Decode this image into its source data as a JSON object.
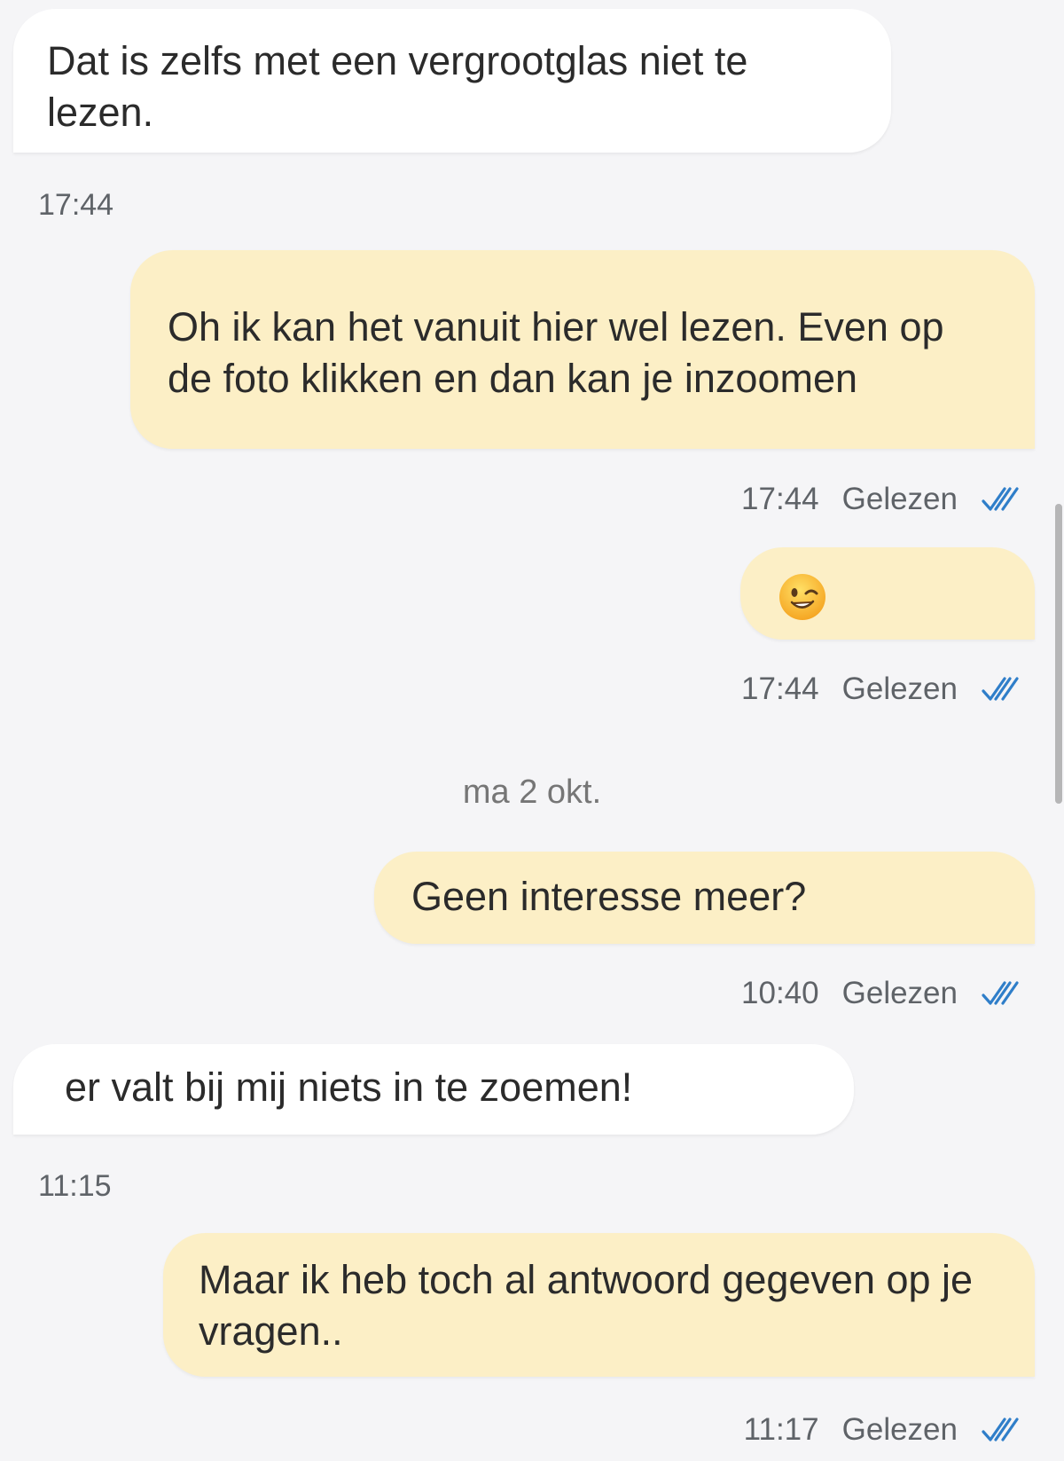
{
  "messages": [
    {
      "text": "Dat is zelfs met een vergrootglas niet te lezen.",
      "time": "17:44"
    },
    {
      "text": "Oh ik kan het vanuit hier wel lezen. Even op de foto klikken en dan kan je inzoomen",
      "time": "17:44",
      "status": "Gelezen"
    },
    {
      "emoji": "winking-face",
      "time": "17:44",
      "status": "Gelezen"
    },
    {
      "text": "Geen interesse meer?",
      "time": "10:40",
      "status": "Gelezen"
    },
    {
      "text": "er valt bij mij niets in te zoemen!",
      "time": "11:15"
    },
    {
      "text": "Maar ik heb toch al antwoord gegeven op je vragen..",
      "time": "11:17",
      "status": "Gelezen"
    }
  ],
  "date_separator": "ma 2 okt.",
  "colors": {
    "incoming_bubble": "#ffffff",
    "outgoing_bubble": "#fcefc6",
    "read_ticks": "#2f7ec9",
    "background": "#f5f5f7"
  },
  "icons": {
    "read_receipt": "double-check-icon",
    "emoji": "winking-face-emoji"
  }
}
